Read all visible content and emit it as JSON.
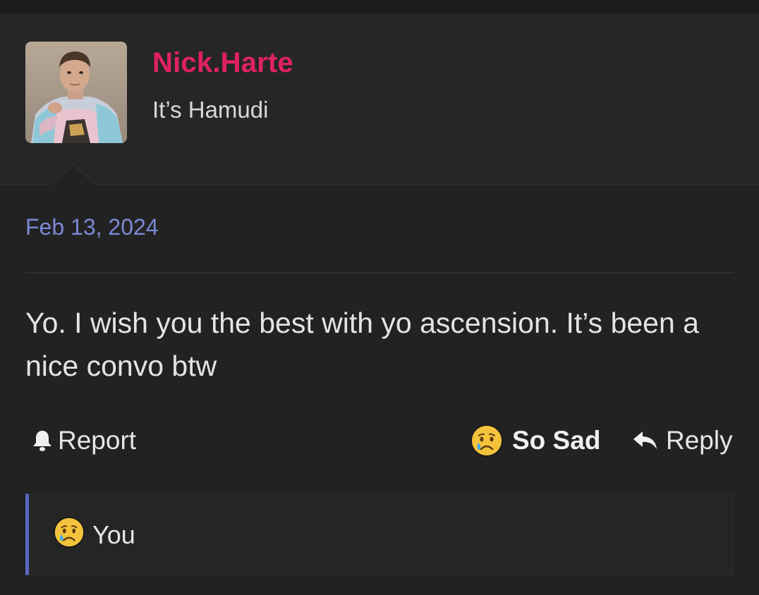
{
  "user": {
    "name": "Nick.Harte",
    "title": "It’s Hamudi",
    "name_color": "#e0235f"
  },
  "post": {
    "date": "Feb 13, 2024",
    "message": "Yo. I wish you the best with yo ascension. It’s been a nice convo btw"
  },
  "actions": {
    "report_label": "Report",
    "reaction_label": "So Sad",
    "reply_label": "Reply",
    "report_icon": "bell-icon",
    "reaction_icon": "crying-face-icon",
    "reply_icon": "reply-arrow-icon"
  },
  "reactions": {
    "icon": "crying-face-icon",
    "summary": "You",
    "accent_color": "#5868c4"
  },
  "colors": {
    "background": "#222222",
    "date_link": "#7b89d6",
    "text": "#e4e4e4"
  }
}
